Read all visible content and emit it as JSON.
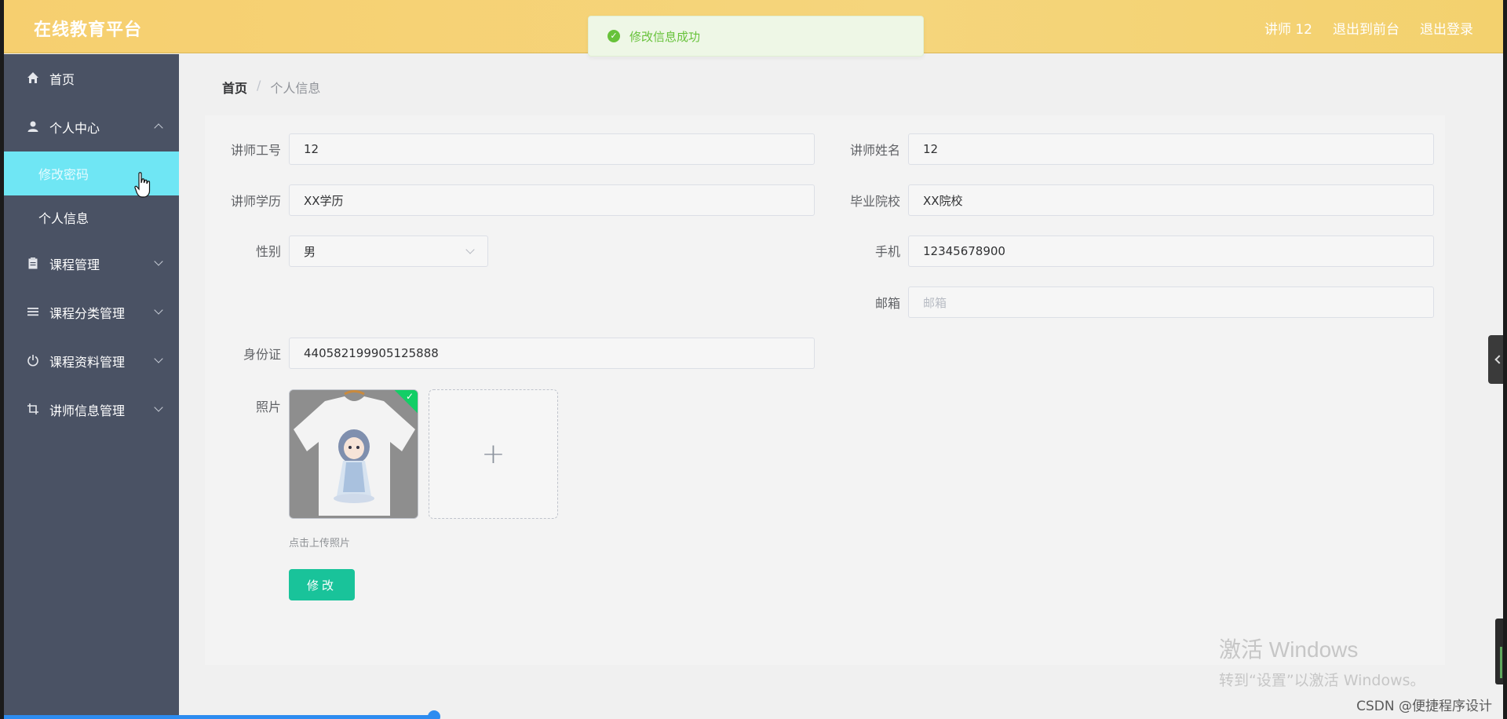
{
  "header": {
    "brand": "在线教育平台",
    "user_label": "讲师 12",
    "front_link": "退出到前台",
    "logout_link": "退出登录"
  },
  "toast": {
    "message": "修改信息成功"
  },
  "sidebar": {
    "items": [
      {
        "label": "首页",
        "icon": "home-icon"
      },
      {
        "label": "个人中心",
        "icon": "user-icon",
        "expanded": true,
        "children": [
          {
            "label": "修改密码",
            "active": true
          },
          {
            "label": "个人信息"
          }
        ]
      },
      {
        "label": "课程管理",
        "icon": "clipboard-icon"
      },
      {
        "label": "课程分类管理",
        "icon": "list-icon"
      },
      {
        "label": "课程资料管理",
        "icon": "power-icon"
      },
      {
        "label": "讲师信息管理",
        "icon": "crop-icon"
      }
    ]
  },
  "breadcrumb": {
    "home": "首页",
    "separator": "/",
    "current": "个人信息"
  },
  "form": {
    "teacher_id": {
      "label": "讲师工号",
      "value": "12"
    },
    "teacher_name": {
      "label": "讲师姓名",
      "value": "12"
    },
    "education": {
      "label": "讲师学历",
      "value": "XX学历"
    },
    "school": {
      "label": "毕业院校",
      "value": "XX院校"
    },
    "gender": {
      "label": "性别",
      "value": "男"
    },
    "phone": {
      "label": "手机",
      "value": "12345678900"
    },
    "email": {
      "label": "邮箱",
      "placeholder": "邮箱",
      "value": ""
    },
    "id_card": {
      "label": "身份证",
      "value": "440582199905125888"
    },
    "photo": {
      "label": "照片",
      "hint": "点击上传照片"
    },
    "submit_label": "修改"
  },
  "watermark": {
    "windows_title": "激活 Windows",
    "windows_sub": "转到“设置”以激活 Windows。",
    "csdn": "CSDN @便捷程序设计"
  },
  "colors": {
    "header": "#f6cf6f",
    "sidebar": "#4a5264",
    "active_submenu": "#6fe6f4",
    "primary_button": "#19c39a",
    "success": "#67c23a"
  }
}
